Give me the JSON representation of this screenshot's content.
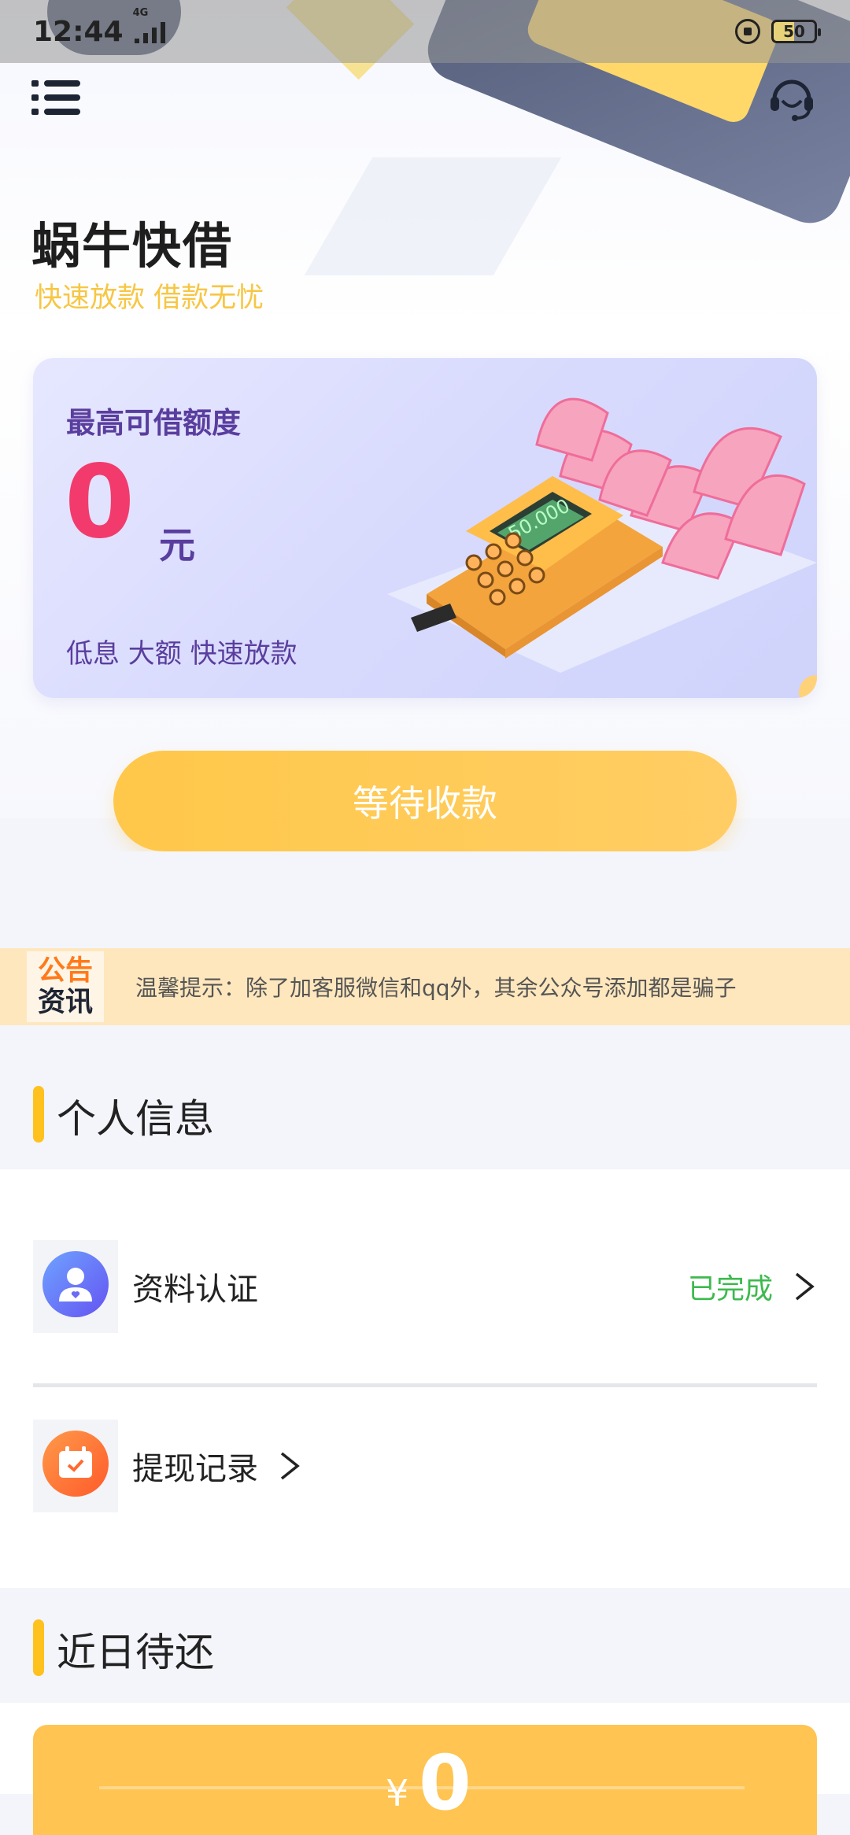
{
  "status_bar": {
    "time": "12:44",
    "network": "4G",
    "battery": "50"
  },
  "header": {
    "title": "蜗牛快借",
    "slogan": "快速放款 借款无忧"
  },
  "credit_card": {
    "label": "最高可借额度",
    "amount": "0",
    "unit": "元",
    "subtitle": "低息 大额 快速放款",
    "pos_screen": "50.000"
  },
  "action": {
    "button_label": "等待收款"
  },
  "notice": {
    "badge_line1": "公告",
    "badge_line2": "资讯",
    "text": "温馨提示：除了加客服微信和qq外，其余公众号添加都是骗子"
  },
  "sections": {
    "personal_title": "个人信息",
    "recent_title": "近日待还"
  },
  "list": [
    {
      "label": "资料认证",
      "status": "已完成"
    },
    {
      "label": "提现记录",
      "status": ""
    }
  ],
  "repay": {
    "currency": "¥",
    "amount": "0"
  },
  "colors": {
    "accent_yellow": "#ffc11e",
    "amount_pink": "#f23b6c",
    "status_green": "#3dba4e",
    "purple_text": "#5a3e9e"
  }
}
